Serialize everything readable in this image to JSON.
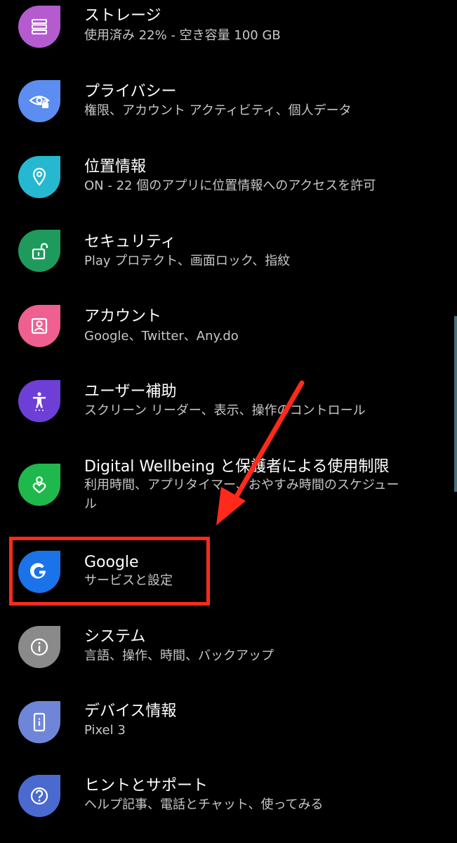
{
  "items": [
    {
      "title": "ストレージ",
      "sub": "使用済み 22% - 空き容量 100 GB",
      "color": "#b55bd0",
      "icon": "storage-icon"
    },
    {
      "title": "プライバシー",
      "sub": "権限、アカウント アクティビティ、個人データ",
      "color": "#5b8ef0",
      "icon": "privacy-eye-lock-icon"
    },
    {
      "title": "位置情報",
      "sub": "ON - 22 個のアプリに位置情報へのアクセスを許可",
      "color": "#25b8d0",
      "icon": "location-pin-icon"
    },
    {
      "title": "セキュリティ",
      "sub": "Play プロテクト、画面ロック、指紋",
      "color": "#1e9b5c",
      "icon": "unlock-icon"
    },
    {
      "title": "アカウント",
      "sub": "Google、Twitter、Any.do",
      "color": "#ef5f8f",
      "icon": "account-icon"
    },
    {
      "title": "ユーザー補助",
      "sub": "スクリーン リーダー、表示、操作のコントロール",
      "color": "#6e3fd6",
      "icon": "accessibility-icon"
    },
    {
      "title": "Digital Wellbeing と保護者による使用制限",
      "sub": "利用時間、アプリタイマー、おやすみ時間のスケジュー",
      "sub2": "ル",
      "color": "#1fb84d",
      "icon": "wellbeing-icon"
    },
    {
      "title": "Google",
      "sub": "サービスと設定",
      "color": "#1a73e8",
      "icon": "google-g-icon"
    },
    {
      "title": "システム",
      "sub": "言語、操作、時間、バックアップ",
      "color": "#8a8a8a",
      "icon": "info-icon"
    },
    {
      "title": "デバイス情報",
      "sub": "Pixel 3",
      "color": "#6f86d8",
      "icon": "phone-info-icon"
    },
    {
      "title": "ヒントとサポート",
      "sub": "ヘルプ記事、電話とチャット、使ってみる",
      "color": "#4a6ad0",
      "icon": "help-icon"
    }
  ],
  "annotation": {
    "arrow_color": "#ff2a1a",
    "box_color": "#ff2a1a"
  }
}
